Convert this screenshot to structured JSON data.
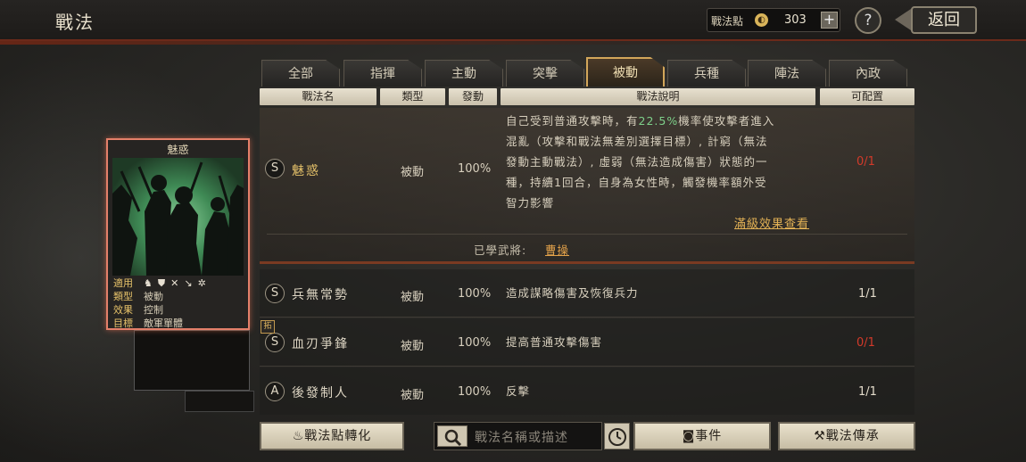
{
  "header": {
    "title": "戰法",
    "points_label": "戰法點",
    "points_value": "303",
    "plus": "+",
    "help": "?",
    "back": "返回"
  },
  "tabs": [
    "全部",
    "指揮",
    "主動",
    "突擊",
    "被動",
    "兵種",
    "陣法",
    "內政"
  ],
  "active_tab": "被動",
  "columns": [
    "戰法名",
    "類型",
    "發動",
    "戰法說明",
    "可配置"
  ],
  "selected": {
    "grade": "S",
    "name": "魅惑",
    "type": "被動",
    "rate": "100%",
    "desc_lines": [
      [
        "自己受到普通攻擊時，有",
        "22.5%",
        "機率使攻擊者進入"
      ],
      [
        "混亂（攻擊和戰法無差別選擇目標）, 計窮（無法",
        "",
        ""
      ],
      [
        "發動主動戰法）, 虛弱（無法造成傷害）狀態的一",
        "",
        ""
      ],
      [
        "種，持續1回合，自身為女性時，觸發機率額外受",
        "",
        ""
      ],
      [
        "智力影響",
        "",
        ""
      ]
    ],
    "count": "0/1",
    "max_link": "滿級效果查看",
    "learned_label": "已學武將:",
    "learned_general": "曹操"
  },
  "rows": [
    {
      "grade": "S",
      "name": "兵無常勢",
      "type": "被動",
      "rate": "100%",
      "desc": "造成謀略傷害及恢復兵力",
      "count": "1/1",
      "count_color": "white"
    },
    {
      "grade": "S",
      "name": "血刃爭鋒",
      "type": "被動",
      "rate": "100%",
      "desc": "提高普通攻擊傷害",
      "count": "0/1",
      "count_color": "red"
    },
    {
      "grade": "A",
      "name": "後發制人",
      "type": "被動",
      "rate": "100%",
      "desc": "反擊",
      "count": "1/1",
      "count_color": "white"
    }
  ],
  "row_tag": "拓",
  "card": {
    "title": "魅惑",
    "applies_label": "適用",
    "applies_icons": [
      "cavalry",
      "shield",
      "archer",
      "spear",
      "siege"
    ],
    "type_label": "類型",
    "type_value": "被動",
    "effect_label": "效果",
    "effect_value": "控制",
    "target_label": "目標",
    "target_value": "敵軍單體"
  },
  "bottom": {
    "convert_button": "戰法點轉化",
    "search_placeholder": "戰法名稱或描述",
    "event_button": "事件",
    "inherit_button": "戰法傳承"
  },
  "colors": {
    "accent": "#d2a65a",
    "highlight_green": "#7ed08a",
    "count_red": "#d23a2a",
    "selected_name": "#e6c26a"
  }
}
